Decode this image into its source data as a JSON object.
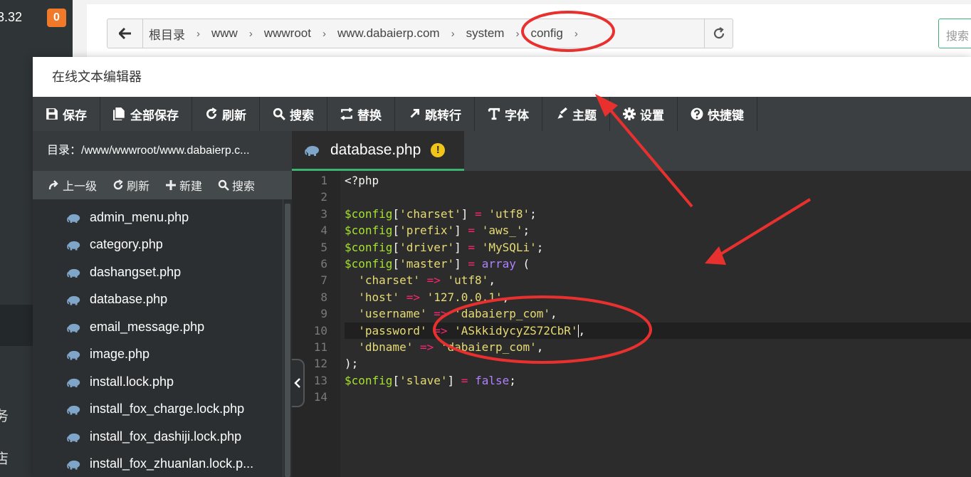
{
  "bg": {
    "ip_fragment": "3.32",
    "badge_count": "0",
    "sidebar_char_1": "务",
    "sidebar_char_2": "店"
  },
  "breadcrumb": {
    "items": [
      "根目录",
      "www",
      "wwwroot",
      "www.dabaierp.com",
      "system",
      "config"
    ],
    "search_placeholder": "搜索"
  },
  "modal": {
    "title": "在线文本编辑器",
    "toolbar": [
      {
        "label": "保存",
        "icon": "save-icon"
      },
      {
        "label": "全部保存",
        "icon": "save-all-icon"
      },
      {
        "label": "刷新",
        "icon": "refresh-icon"
      },
      {
        "label": "搜索",
        "icon": "search-icon"
      },
      {
        "label": "替换",
        "icon": "replace-icon"
      },
      {
        "label": "跳转行",
        "icon": "jump-line-icon"
      },
      {
        "label": "字体",
        "icon": "font-icon"
      },
      {
        "label": "主题",
        "icon": "theme-icon"
      },
      {
        "label": "设置",
        "icon": "gear-icon"
      },
      {
        "label": "快捷键",
        "icon": "question-icon"
      }
    ]
  },
  "sidebar": {
    "path": "目录：/www/wwwroot/www.dabaierp.c...",
    "actions": [
      {
        "label": "上一级",
        "icon": "up-level-icon"
      },
      {
        "label": "刷新",
        "icon": "refresh-icon"
      },
      {
        "label": "新建",
        "icon": "plus-icon"
      },
      {
        "label": "搜索",
        "icon": "search-icon"
      }
    ],
    "files": [
      "admin_menu.php",
      "category.php",
      "dashangset.php",
      "database.php",
      "email_message.php",
      "image.php",
      "install.lock.php",
      "install_fox_charge.lock.php",
      "install_fox_dashiji.lock.php",
      "install_fox_zhuanlan.lock.p..."
    ]
  },
  "editor": {
    "tab_name": "database.php",
    "tab_warning": "!",
    "line_numbers": [
      "1",
      "2",
      "3",
      "4",
      "5",
      "6",
      "7",
      "8",
      "9",
      "10",
      "11",
      "12",
      "13",
      "14"
    ],
    "code": {
      "l1": "<?php",
      "var": "$config",
      "k_charset": "'charset'",
      "v_utf8": "'utf8'",
      "k_prefix": "'prefix'",
      "v_prefix": "'aws_'",
      "k_driver": "'driver'",
      "v_driver": "'MySQLi'",
      "k_master": "'master'",
      "kw_array": "array",
      "k_host": "'host'",
      "v_host": "'127.0.0.1'",
      "k_username": "'username'",
      "v_username": "'dabaierp_com'",
      "k_password": "'password'",
      "v_password": "'ASkkidycyZS72CbR'",
      "k_dbname": "'dbname'",
      "v_dbname": "'dabaierp_com'",
      "k_slave": "'slave'",
      "kw_false": "false"
    }
  },
  "colors": {
    "accent_green": "#3cb371",
    "annotation_red": "#e8312f",
    "toolbar_bg": "#3b3f41",
    "badge_orange": "#f07a29"
  }
}
